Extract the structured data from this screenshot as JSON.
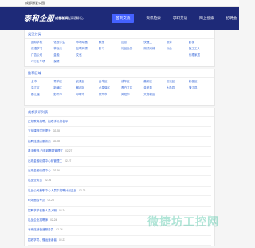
{
  "topbar": {
    "text": "成都博爱公园"
  },
  "header": {
    "logo": "泰和企服",
    "subtitle_bold": "成都新闻",
    "subtitle": "(双语解析)"
  },
  "nav": [
    {
      "label": "首页交流",
      "active": true
    },
    {
      "label": "资讯检索",
      "active": false
    },
    {
      "label": "求职英语",
      "active": false
    },
    {
      "label": "网上搜索",
      "active": false
    },
    {
      "label": "招聘会",
      "active": false
    }
  ],
  "categories": {
    "title": "类型分类",
    "items": [
      "国际学校",
      "化妆学生",
      "市场动画",
      "教授",
      "加点",
      "快速工",
      "服务",
      "影视",
      "双语学习",
      "事业法",
      "互联网课",
      "影习",
      "礼品业务",
      "测试维修",
      "行业",
      "施工工人",
      "广告公司",
      "金融",
      "文化",
      "",
      "",
      "",
      "",
      "代理家居",
      "IT行业专项",
      "保健",
      "",
      "",
      "",
      "",
      "",
      ""
    ]
  },
  "regions": {
    "title": "推荐区域",
    "items": [
      "全市",
      "青羊区",
      "武侯区",
      "金牛区",
      "成华区",
      "高新区",
      "双流区",
      "新都区",
      "温江区",
      "新津区",
      "郫都区",
      "龙泉驿区",
      "青白江区",
      "金堂县",
      "大邑县",
      "蒲江县",
      "都江堰",
      "彭州市",
      "邛崃市",
      "崇州市",
      "简阳市",
      "天府新区",
      "",
      "",
      "",
      "",
      "",
      "",
      "",
      "",
      "",
      ""
    ]
  },
  "news": {
    "title": "成都资讯列表",
    "items": [
      {
        "text": "正规教育招聘、招收学员报名中",
        "date": ""
      },
      {
        "text": "文化课程学历提升",
        "date": "02-28"
      },
      {
        "text": "招聘连锁店服务员",
        "date": "02-28"
      },
      {
        "text": "着手教程,白蓝城需要管理工",
        "date": "02-27"
      },
      {
        "text": "出现金融收费中心前管理工",
        "date": "02-27"
      },
      {
        "text": "出现金融收费中心",
        "date": "02-26"
      },
      {
        "text": "礼品业务员",
        "date": "02-26"
      },
      {
        "text": "礼品公司兼职中心人员中招聘计划正品",
        "date": "02-26"
      },
      {
        "text": "职场面容专员",
        "date": "02-25"
      },
      {
        "text": "招聘求学者服人员入职",
        "date": "02-24"
      },
      {
        "text": "礼品企业招聘师",
        "date": "02-24"
      },
      {
        "text": "专案连锁快递服务员",
        "date": "02-24"
      },
      {
        "text": "招收学员、懂运营者者",
        "date": "02-23"
      }
    ]
  },
  "watermark": "微捷坊工控网"
}
